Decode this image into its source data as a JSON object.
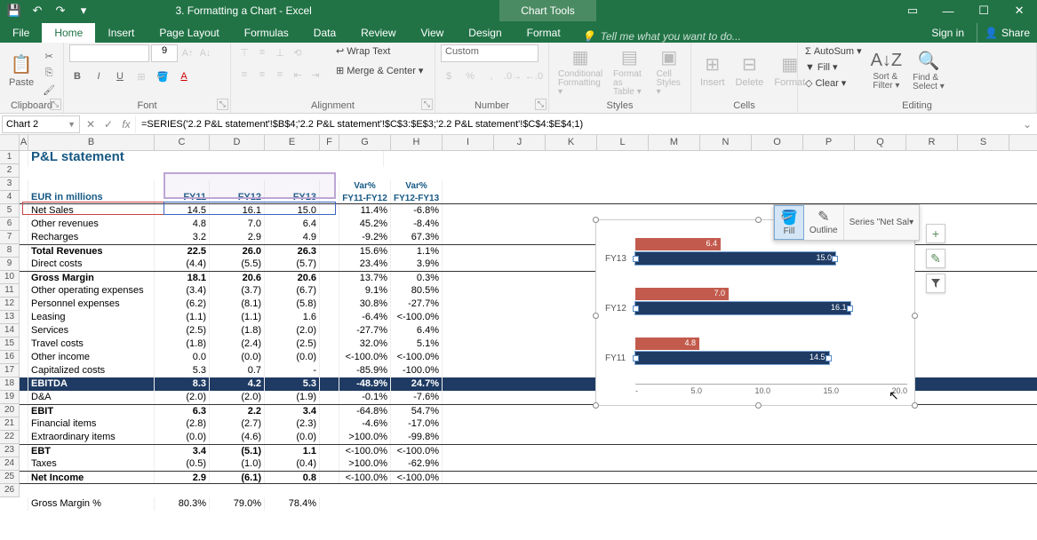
{
  "titlebar": {
    "title": "3. Formatting a Chart - Excel",
    "chart_tools": "Chart Tools"
  },
  "tabs": {
    "file": "File",
    "home": "Home",
    "insert": "Insert",
    "pagelayout": "Page Layout",
    "formulas": "Formulas",
    "data": "Data",
    "review": "Review",
    "view": "View",
    "design": "Design",
    "format": "Format",
    "tellme": "Tell me what you want to do...",
    "signin": "Sign in",
    "share": "Share"
  },
  "ribbon": {
    "clipboard": {
      "paste": "Paste",
      "label": "Clipboard"
    },
    "font": {
      "size": "9",
      "label": "Font"
    },
    "alignment": {
      "wrap": "Wrap Text",
      "merge": "Merge & Center",
      "label": "Alignment"
    },
    "number": {
      "format": "Custom",
      "label": "Number"
    },
    "styles": {
      "cond": "Conditional Formatting",
      "fmt": "Format as Table",
      "cell": "Cell Styles",
      "label": "Styles"
    },
    "cells": {
      "insert": "Insert",
      "delete": "Delete",
      "format": "Format",
      "label": "Cells"
    },
    "editing": {
      "autosum": "AutoSum",
      "fill": "Fill",
      "clear": "Clear",
      "sort": "Sort & Filter",
      "find": "Find & Select",
      "label": "Editing"
    }
  },
  "formula_bar": {
    "name_box": "Chart 2",
    "formula": "=SERIES('2.2 P&L statement'!$B$4;'2.2 P&L statement'!$C$3:$E$3;'2.2 P&L statement'!$C$4:$E$4;1)"
  },
  "columns": [
    "A",
    "B",
    "C",
    "D",
    "E",
    "F",
    "G",
    "H",
    "I",
    "J",
    "K",
    "L",
    "M",
    "N",
    "O",
    "P",
    "Q",
    "R",
    "S"
  ],
  "sheet": {
    "title": "P&L statement",
    "headers": {
      "b": "EUR in millions",
      "c": "FY11",
      "d": "FY12",
      "e": "FY13",
      "g1": "Var%",
      "g2": "FY11-FY12",
      "h1": "Var%",
      "h2": "FY12-FY13"
    },
    "rows": [
      {
        "name": "Net Sales",
        "c": "14.5",
        "d": "16.1",
        "e": "15.0",
        "g": "11.4%",
        "h": "-6.8%"
      },
      {
        "name": "Other revenues",
        "c": "4.8",
        "d": "7.0",
        "e": "6.4",
        "g": "45.2%",
        "h": "-8.4%"
      },
      {
        "name": "Recharges",
        "c": "3.2",
        "d": "2.9",
        "e": "4.9",
        "g": "-9.2%",
        "h": "67.3%"
      },
      {
        "name": "Total Revenues",
        "c": "22.5",
        "d": "26.0",
        "e": "26.3",
        "g": "15.6%",
        "h": "1.1%",
        "bold": true,
        "bt": true
      },
      {
        "name": "Direct costs",
        "c": "(4.4)",
        "d": "(5.5)",
        "e": "(5.7)",
        "g": "23.4%",
        "h": "3.9%"
      },
      {
        "name": "Gross Margin",
        "c": "18.1",
        "d": "20.6",
        "e": "20.6",
        "g": "13.7%",
        "h": "0.3%",
        "bold": true,
        "bt": true
      },
      {
        "name": "Other operating expenses",
        "c": "(3.4)",
        "d": "(3.7)",
        "e": "(6.7)",
        "g": "9.1%",
        "h": "80.5%"
      },
      {
        "name": "Personnel expenses",
        "c": "(6.2)",
        "d": "(8.1)",
        "e": "(5.8)",
        "g": "30.8%",
        "h": "-27.7%"
      },
      {
        "name": "Leasing",
        "c": "(1.1)",
        "d": "(1.1)",
        "e": "1.6",
        "g": "-6.4%",
        "h": "<-100.0%"
      },
      {
        "name": "Services",
        "c": "(2.5)",
        "d": "(1.8)",
        "e": "(2.0)",
        "g": "-27.7%",
        "h": "6.4%"
      },
      {
        "name": "Travel costs",
        "c": "(1.8)",
        "d": "(2.4)",
        "e": "(2.5)",
        "g": "32.0%",
        "h": "5.1%"
      },
      {
        "name": "Other income",
        "c": "0.0",
        "d": "(0.0)",
        "e": "(0.0)",
        "g": "<-100.0%",
        "h": "<-100.0%"
      },
      {
        "name": "Capitalized costs",
        "c": "5.3",
        "d": "0.7",
        "e": "-",
        "g": "-85.9%",
        "h": "-100.0%"
      },
      {
        "name": "EBITDA",
        "c": "8.3",
        "d": "4.2",
        "e": "5.3",
        "g": "-48.9%",
        "h": "24.7%",
        "ebitda": true
      },
      {
        "name": "D&A",
        "c": "(2.0)",
        "d": "(2.0)",
        "e": "(1.9)",
        "g": "-0.1%",
        "h": "-7.6%"
      },
      {
        "name": "EBIT",
        "c": "6.3",
        "d": "2.2",
        "e": "3.4",
        "g": "-64.8%",
        "h": "54.7%",
        "bold": true,
        "bt": true
      },
      {
        "name": "Financial items",
        "c": "(2.8)",
        "d": "(2.7)",
        "e": "(2.3)",
        "g": "-4.6%",
        "h": "-17.0%"
      },
      {
        "name": "Extraordinary items",
        "c": "(0.0)",
        "d": "(4.6)",
        "e": "(0.0)",
        "g": ">100.0%",
        "h": "-99.8%"
      },
      {
        "name": "EBT",
        "c": "3.4",
        "d": "(5.1)",
        "e": "1.1",
        "g": "<-100.0%",
        "h": "<-100.0%",
        "bold": true,
        "bt": true
      },
      {
        "name": "Taxes",
        "c": "(0.5)",
        "d": "(1.0)",
        "e": "(0.4)",
        "g": ">100.0%",
        "h": "-62.9%"
      },
      {
        "name": "Net Income",
        "c": "2.9",
        "d": "(6.1)",
        "e": "0.8",
        "g": "<-100.0%",
        "h": "<-100.0%",
        "bold": true,
        "bt": true,
        "bb": true
      }
    ],
    "gm_row": {
      "name": "Gross Margin %",
      "c": "80.3%",
      "d": "79.0%",
      "e": "78.4%"
    }
  },
  "chart_data": {
    "type": "bar",
    "orientation": "horizontal",
    "categories": [
      "FY13",
      "FY12",
      "FY11"
    ],
    "series": [
      {
        "name": "Other revenues",
        "values": [
          6.4,
          7.0,
          4.8
        ],
        "color": "#c25b4d"
      },
      {
        "name": "Net Sales",
        "values": [
          15.0,
          16.1,
          14.5
        ],
        "color": "#1f3b63",
        "selected": true
      }
    ],
    "x_ticks": [
      "-",
      "5.0",
      "10.0",
      "15.0",
      "20.0"
    ],
    "xlim": [
      0,
      20
    ]
  },
  "mini_toolbar": {
    "fill": "Fill",
    "outline": "Outline",
    "series": "Series \"Net Sal"
  },
  "side_buttons": {
    "plus": "+",
    "brush": "✎",
    "filter": "▼"
  }
}
